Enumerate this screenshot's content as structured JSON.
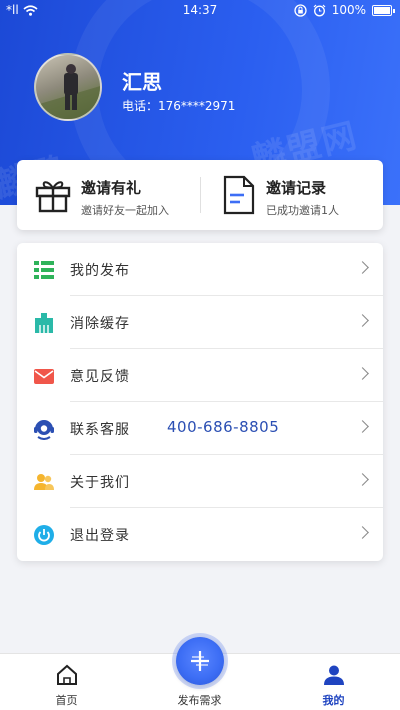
{
  "status_bar": {
    "signal": "*ll",
    "time": "14:37",
    "battery": "100%"
  },
  "watermark": {
    "text_left": "麟鹏",
    "text_right": "麟盟网"
  },
  "profile": {
    "name": "汇思",
    "phone": "电话：176****2971"
  },
  "invite": {
    "left": {
      "title": "邀请有礼",
      "subtitle": "邀请好友一起加入",
      "icon": "gift-icon"
    },
    "right": {
      "title": "邀请记录",
      "subtitle": "已成功邀请1人",
      "icon": "document-icon"
    }
  },
  "menu": [
    {
      "label": "我的发布",
      "icon": "list-icon",
      "color": "#2fb35a"
    },
    {
      "label": "消除缓存",
      "icon": "broom-icon",
      "color": "#2ab9a8"
    },
    {
      "label": "意见反馈",
      "icon": "mail-icon",
      "color": "#f0564a"
    },
    {
      "label": "联系客服",
      "value": "400-686-8805",
      "icon": "headset-icon",
      "color": "#2b4fb3"
    },
    {
      "label": "关于我们",
      "icon": "users-icon",
      "color": "#f5b52e"
    },
    {
      "label": "退出登录",
      "icon": "power-icon",
      "color": "#1faee8"
    }
  ],
  "nav": {
    "home": "首页",
    "publish": "发布需求",
    "mine": "我的"
  },
  "colors": {
    "primary": "#2554e6",
    "active_nav": "#1f44c0"
  }
}
